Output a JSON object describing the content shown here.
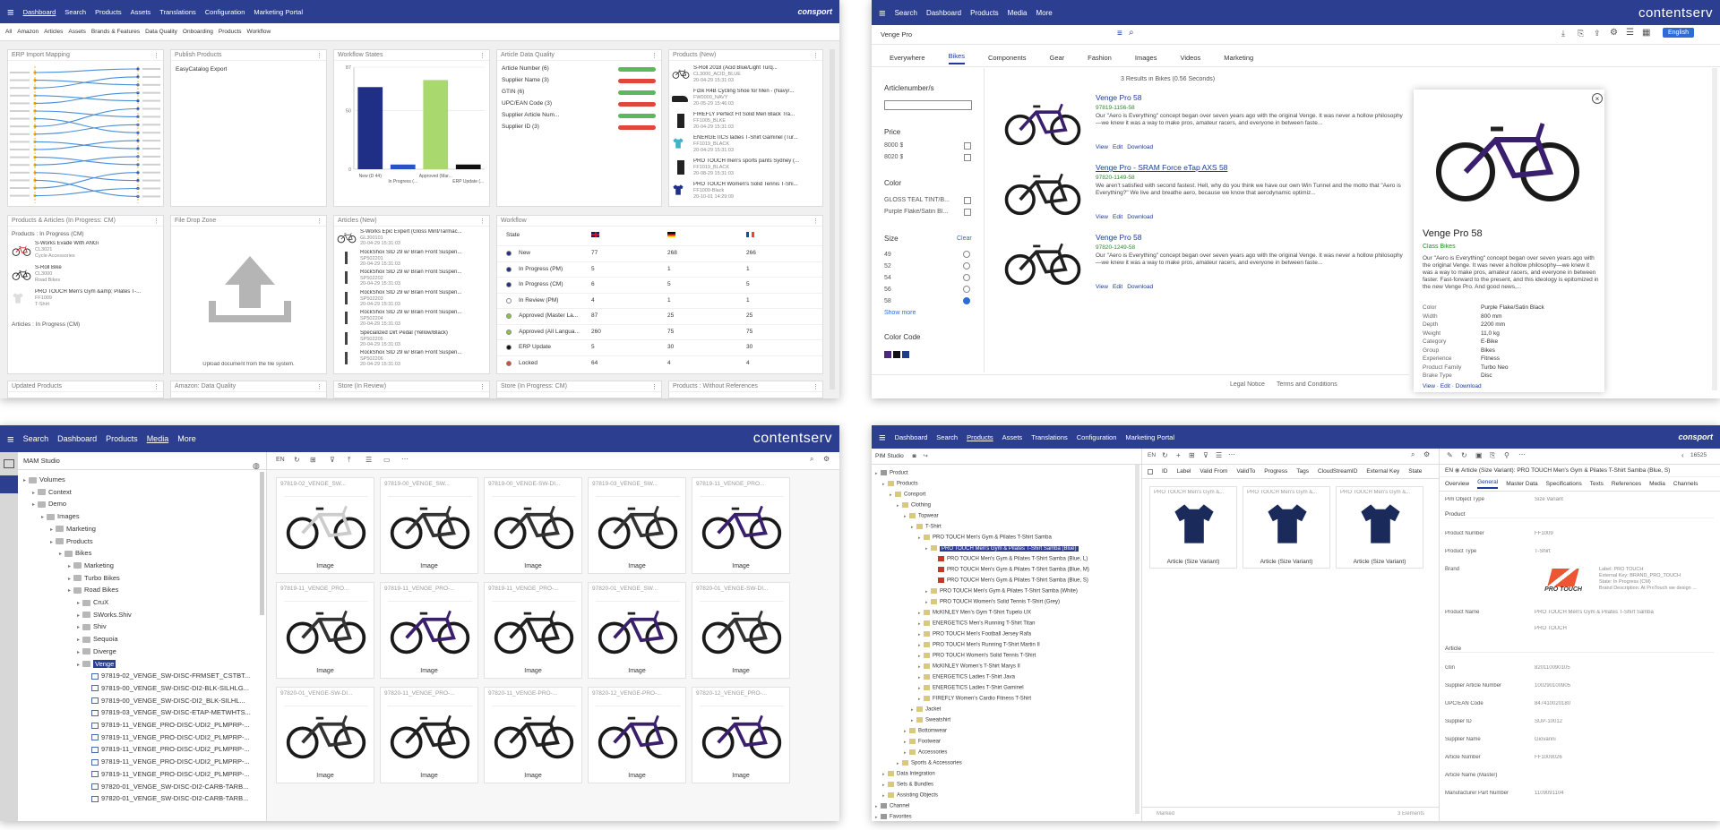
{
  "dash": {
    "nav": [
      "Dashboard",
      "Search",
      "Products",
      "Assets",
      "Translations",
      "Configuration",
      "Marketing Portal"
    ],
    "brand": "consport",
    "subnav": [
      "All",
      "Amazon",
      "Articles",
      "Assets",
      "Brands & Features",
      "Data Quality",
      "Onboarding",
      "Products",
      "Workflow"
    ],
    "cards": {
      "erp": "ERP Import Mapping",
      "publish": "Publish Products",
      "publish_item": "EasyCatalog Export",
      "wf_states": "Workflow States",
      "quality": "Article Data Quality",
      "prod_new": "Products (New)",
      "prod_art": "Products & Articles (In Progress: CM)",
      "drop": "File Drop Zone",
      "art_new": "Articles (New)",
      "workflow": "Workflow",
      "updated": "Updated Products",
      "amazon": "Amazon: Data Quality",
      "store_rev": "Store (In Review)",
      "store_prog": "Store (In Progress: CM)",
      "prod_noref": "Products : Without References"
    },
    "wf_bars": [
      {
        "label": "New (D 44)",
        "value": 70,
        "color": "#1f2f86"
      },
      {
        "label": "In Progress (...",
        "value": 4,
        "color": "#2b50c7"
      },
      {
        "label": "Approved (Mar...",
        "value": 76,
        "color": "#a8d86e"
      },
      {
        "label": "ERP Update (...",
        "value": 4,
        "color": "#111111"
      }
    ],
    "wf_ymax": 87,
    "wf_yticks": [
      "87",
      "50",
      "0"
    ],
    "quality_rows": [
      {
        "label": "Article Number (6)",
        "color": "#5cb85c"
      },
      {
        "label": "Supplier Name (3)",
        "color": "#e0473c"
      },
      {
        "label": "GTIN (6)",
        "color": "#5cb85c"
      },
      {
        "label": "UPC/EAN Code (3)",
        "color": "#e0473c"
      },
      {
        "label": "Supplier Article Num...",
        "color": "#5cb85c"
      },
      {
        "label": "Supplier ID (3)",
        "color": "#e0473c"
      }
    ],
    "prod_new_items": [
      {
        "t": "S-Roll 2018 (Acid Blue/Light Turq...",
        "s": "CL3000_ACID_BLUE",
        "d": "20-04-29 15:31:03"
      },
      {
        "t": "Fizik R4B Cycling Shoe for Men - (Navy/...",
        "s": "FW0000_NAVY",
        "d": "20-05-29 15:46:03"
      },
      {
        "t": "FIREFLY Perfect Fit Solid Men Black Tra...",
        "s": "FF1005_BLKE",
        "d": "20-04-29 15:31:03"
      },
      {
        "t": "ENERGETICS ladies T-Shirt Gaminel (Tur...",
        "s": "FF1019_BLACK",
        "d": "20-04-29 15:31:03"
      },
      {
        "t": "PRO TOUCH men's sports pants Sydney (...",
        "s": "FF1019_BLACK",
        "d": "20-08-29 15:31:03"
      },
      {
        "t": "PRO TOUCH Women's Solid Tennis T-Shi...",
        "s": "FF1009-Black",
        "d": "20-10-01 14:29:09"
      }
    ],
    "pa_head": "Products : In Progress (CM)",
    "pa_items": [
      {
        "t": "S-Works Evade With ANGi",
        "s": "CL3021",
        "u": "Cycle Accessories"
      },
      {
        "t": "S-Roll Bike",
        "s": "CL3000",
        "u": "Road Bikes"
      },
      {
        "t": "PRO TOUCH Men's Gym &amp; Pilates T-...",
        "s": "FF1009",
        "u": "T-Shirt"
      }
    ],
    "pa_foot": "Articles : In Progress (CM)",
    "drop_text": "Upload document from the file system.",
    "art_items": [
      {
        "t": "S-Works Epic Expert (Gloss Mint/Tarmac...",
        "s": "GL300101",
        "d": "20-04-29 15:31:03"
      },
      {
        "t": "RockShox SID 29 w/ Brain Front Suspen...",
        "s": "SP502201",
        "d": "20-04-29 15:31:03"
      },
      {
        "t": "RockShox SID 29 w/ Brain Front Suspen...",
        "s": "SP502202",
        "d": "20-04-29 15:31:03"
      },
      {
        "t": "RockShox SID 29 w/ Brain Front Suspen...",
        "s": "SP502203",
        "d": "20-04-29 15:31:03"
      },
      {
        "t": "RockShox SID 29 w/ Brain Front Suspen...",
        "s": "SP502204",
        "d": "20-04-29 15:31:03"
      },
      {
        "t": "Specialized Dirt Pedal (Yellow/Black)",
        "s": "SP502205",
        "d": "20-04-29 15:31:03"
      },
      {
        "t": "RockShox SID 29 w/ Brain Front Suspen...",
        "s": "SP502206",
        "d": "20-04-29 15:31:03"
      }
    ],
    "wf_table_head": "State",
    "wf_rows": [
      {
        "s": "New",
        "a": "77",
        "b": "268",
        "c": "266",
        "col": "#1f2f86"
      },
      {
        "s": "In Progress (PM)",
        "a": "5",
        "b": "1",
        "c": "1",
        "col": "#1f2f86"
      },
      {
        "s": "In Progress (CM)",
        "a": "6",
        "b": "5",
        "c": "5",
        "col": "#1f2f86"
      },
      {
        "s": "In Review (PM)",
        "a": "4",
        "b": "1",
        "c": "1",
        "col": "#ffffff"
      },
      {
        "s": "Approved (Master La...",
        "a": "87",
        "b": "25",
        "c": "25",
        "col": "#8bc34a"
      },
      {
        "s": "Approved (All Langua...",
        "a": "260",
        "b": "75",
        "c": "75",
        "col": "#8bc34a"
      },
      {
        "s": "ERP Update",
        "a": "5",
        "b": "30",
        "c": "30",
        "col": "#111111"
      },
      {
        "s": "Locked",
        "a": "64",
        "b": "4",
        "c": "4",
        "col": "#e0473c"
      }
    ]
  },
  "search": {
    "query": "Venge Pro",
    "nav": [
      "Search",
      "Dashboard",
      "Products",
      "Media",
      "More"
    ],
    "brand": "contentserv",
    "lang": "English",
    "tabs": [
      "Everywhere",
      "Bikes",
      "Components",
      "Gear",
      "Fashion",
      "Images",
      "Videos",
      "Marketing"
    ],
    "facets": {
      "artnum": "Articlenumber/s",
      "price": "Price",
      "prices": [
        "8000 $",
        "8020 $"
      ],
      "color": "Color",
      "colors": [
        "GLOSS TEAL TINT/B...",
        "Purple Flake/Satin Bl..."
      ],
      "size": "Size",
      "clear": "Clear",
      "sizes": [
        "49",
        "52",
        "54",
        "56",
        "58"
      ],
      "show_more": "Show more",
      "colorcode": "Color Code"
    },
    "results_count": "3 Results in Bikes (0.56 Seconds)",
    "results": [
      {
        "title": "Venge Pro 58",
        "id": "97819-1156-58",
        "desc": "Our \"Aero is Everything\" concept began over seven years ago with the original Venge. It was never a hollow philosophy—we knew it was a way to make pros, amateur racers, and everyone in between faste..."
      },
      {
        "title": "Venge Pro - SRAM Force eTap AXS 58",
        "id": "97820-1149-58",
        "desc": "We aren't satisfied with second fastest. Hell, why do you think we have our own Win Tunnel and the motto that \"Aero is Everything?\" We live and breathe aero, because we know that aerodynamic optimiz..."
      },
      {
        "title": "Venge Pro 58",
        "id": "97820-1249-58",
        "desc": "Our \"Aero is Everything\" concept began over seven years ago with the original Venge. It was never a hollow philosophy—we knew it was a way to make pros, amateur racers, and everyone in between faste..."
      }
    ],
    "links": [
      "View",
      "Edit",
      "Download"
    ],
    "detail": {
      "title": "Venge Pro 58",
      "class": "Class Bikes",
      "desc": "Our \"Aero is Everything\" concept began over seven years ago with the original Venge. It was never a hollow philosophy—we knew it was a way to make pros, amateur racers, and everyone in between faster. Fast-forward to the present, and this ideology is epitomized in the new Venge Pro. And good news,...",
      "props": [
        [
          "Color",
          "Purple Flake/Satin Black"
        ],
        [
          "Width",
          "800 mm"
        ],
        [
          "Depth",
          "2200 mm"
        ],
        [
          "Weight",
          "11,0 kg"
        ],
        [
          "Category",
          "E-Bike"
        ],
        [
          "Group",
          "Bikes"
        ],
        [
          "Experience",
          "Fitness"
        ],
        [
          "Product Family",
          "Turbo Neo"
        ],
        [
          "Brake Type",
          "Disc"
        ]
      ]
    },
    "footer": [
      "Legal Notice",
      "Terms and Conditions"
    ]
  },
  "mam": {
    "nav": [
      "Search",
      "Dashboard",
      "Products",
      "Media",
      "More"
    ],
    "brand": "contentserv",
    "title": "MAM Studio",
    "lang": "EN",
    "tree": [
      {
        "t": "Volumes",
        "l": 0,
        "k": "f"
      },
      {
        "t": "Context",
        "l": 1,
        "k": "f"
      },
      {
        "t": "Demo",
        "l": 1,
        "k": "f"
      },
      {
        "t": "Images",
        "l": 2,
        "k": "f"
      },
      {
        "t": "Marketing",
        "l": 3,
        "k": "f"
      },
      {
        "t": "Products",
        "l": 3,
        "k": "f"
      },
      {
        "t": "Bikes",
        "l": 4,
        "k": "f"
      },
      {
        "t": "Marketing",
        "l": 5,
        "k": "f"
      },
      {
        "t": "Turbo Bikes",
        "l": 5,
        "k": "f"
      },
      {
        "t": "Road Bikes",
        "l": 5,
        "k": "f"
      },
      {
        "t": "CruX",
        "l": 6,
        "k": "f"
      },
      {
        "t": "SWorks.Shiv",
        "l": 6,
        "k": "f"
      },
      {
        "t": "Shiv",
        "l": 6,
        "k": "f"
      },
      {
        "t": "Sequoia",
        "l": 6,
        "k": "f"
      },
      {
        "t": "Diverge",
        "l": 6,
        "k": "f"
      },
      {
        "t": "Venge",
        "l": 6,
        "k": "s"
      },
      {
        "t": "97819-02_VENGE_SW-DISC-FRMSET_CSTBT...",
        "l": 7,
        "k": "i"
      },
      {
        "t": "97819-00_VENGE_SW-DISC-DI2-BLK-SILHLG...",
        "l": 7,
        "k": "i"
      },
      {
        "t": "97819-00_VENGE_SW-DISC-DI2_BLK-SILHL...",
        "l": 7,
        "k": "i"
      },
      {
        "t": "97819-03_VENGE_SW-DISC-ETAP-METWHTS...",
        "l": 7,
        "k": "i"
      },
      {
        "t": "97819-11_VENGE_PRO-DISC-UDI2_PLMPRP-...",
        "l": 7,
        "k": "i"
      },
      {
        "t": "97819-11_VENGE_PRO-DISC-UDI2_PLMPRP-...",
        "l": 7,
        "k": "i"
      },
      {
        "t": "97819-11_VENGE_PRO-DISC-UDI2_PLMPRP-...",
        "l": 7,
        "k": "i"
      },
      {
        "t": "97819-11_VENGE_PRO-DISC-UDI2_PLMPRP-...",
        "l": 7,
        "k": "i"
      },
      {
        "t": "97819-11_VENGE_PRO-DISC-UDI2_PLMPRP-...",
        "l": 7,
        "k": "i"
      },
      {
        "t": "97820-01_VENGE_SW-DISC-DI2-CARB-TARB...",
        "l": 7,
        "k": "i"
      },
      {
        "t": "97820-01_VENGE_SW-DISC-DI2-CARB-TARB...",
        "l": 7,
        "k": "i"
      }
    ],
    "grid": [
      "97819-02_VENGE_SW...",
      "97819-00_VENGE_SW...",
      "97819-00_VENGE-SW-DI...",
      "97819-03_VENGE_SW...",
      "97819-11_VENGE_PRO...",
      "97819-11_VENGE_PRO...",
      "97819-11_VENGE_PRO-...",
      "97819-11_VENGE_PRO-...",
      "97820-01_VENGE_SW...",
      "97820-01_VENGE-SW-DI...",
      "97820-01_VENGE-SW-DI...",
      "97820-11_VENGE_PRO-...",
      "97820-11_VENGE-PRO-...",
      "97820-12_VENGE-PRO-...",
      "97820-12_VENGE_PRO-..."
    ],
    "caption": "Image"
  },
  "pim": {
    "nav": [
      "Dashboard",
      "Search",
      "Products",
      "Assets",
      "Translations",
      "Configuration",
      "Marketing Portal"
    ],
    "brand": "consport",
    "studio": "PIM Studio",
    "tree": [
      {
        "t": "Product",
        "l": 0
      },
      {
        "t": "Products",
        "l": 1
      },
      {
        "t": "Consport",
        "l": 2
      },
      {
        "t": "Clothing",
        "l": 3
      },
      {
        "t": "Topwear",
        "l": 4
      },
      {
        "t": "T-Shirt",
        "l": 5
      },
      {
        "t": "PRO TOUCH Men's Gym & Pilates T-Shirt Samba",
        "l": 6
      },
      {
        "t": "PRO TOUCH Men's Gym & Pilates T-Shirt Samba (Blue)",
        "l": 7,
        "sel": true
      },
      {
        "t": "PRO TOUCH Men's Gym & Pilates T-Shirt Samba (Blue, L)",
        "l": 8
      },
      {
        "t": "PRO TOUCH Men's Gym & Pilates T-Shirt Samba (Blue, M)",
        "l": 8
      },
      {
        "t": "PRO TOUCH Men's Gym & Pilates T-Shirt Samba (Blue, S)",
        "l": 8
      },
      {
        "t": "PRO TOUCH Men's Gym & Pilates T-Shirt Samba (White)",
        "l": 7
      },
      {
        "t": "PRO TOUCH Women's Solid Tennis T-Shirt (Grey)",
        "l": 7
      },
      {
        "t": "McKINLEY Men's Gym T-Shirt Tupelo UX",
        "l": 6
      },
      {
        "t": "ENERGETICS Men's Running T-Shirt Titan",
        "l": 6
      },
      {
        "t": "PRO TOUCH Men's Football Jersey Rafa",
        "l": 6
      },
      {
        "t": "PRO TOUCH Men's Running T-Shirt Martin II",
        "l": 6
      },
      {
        "t": "PRO TOUCH Women's Solid Tennis T-Shirt",
        "l": 6
      },
      {
        "t": "McKINLEY Women's T-Shirt Marys II",
        "l": 6
      },
      {
        "t": "ENERGETICS Ladies T-Shirt Java",
        "l": 6
      },
      {
        "t": "ENERGETICS Ladies T-Shirt Gaminel",
        "l": 6
      },
      {
        "t": "FIREFLY Women's Cardio Fitness T-Shirt",
        "l": 6
      },
      {
        "t": "Jacket",
        "l": 5
      },
      {
        "t": "Sweatshirt",
        "l": 5
      },
      {
        "t": "Bottomwear",
        "l": 4
      },
      {
        "t": "Footwear",
        "l": 4
      },
      {
        "t": "Accessories",
        "l": 4
      },
      {
        "t": "Sports & Accessories",
        "l": 3
      },
      {
        "t": "Data Integration",
        "l": 1
      },
      {
        "t": "Sets & Bundles",
        "l": 1
      },
      {
        "t": "Assisting Objects",
        "l": 1
      },
      {
        "t": "Channel",
        "l": 0
      },
      {
        "t": "Favorites",
        "l": 0
      }
    ],
    "mid_cols": [
      "ID",
      "Label",
      "Valid From",
      "ValidTo",
      "Progress",
      "Tags",
      "CloudStreamID",
      "External Key",
      "State"
    ],
    "mid_cards": [
      "PRO TOUCH Men's Gym &...",
      "PRO TOUCH Men's Gym &...",
      "PRO TOUCH Men's Gym &..."
    ],
    "mid_caption": "Article (Size Variant)",
    "mid_lang": "EN",
    "mid_footer_l": "Marked",
    "mid_footer_r": "3 Elements",
    "right_path": "Article (Size Variant): PRO TOUCH Men's Gym & Pilates T-Shirt Samba (Blue, S)",
    "right_lang": "EN",
    "count": "16525",
    "right_tabs": [
      "Overview",
      "General",
      "Master Data",
      "Specifications",
      "Texts",
      "References",
      "Media",
      "Channels"
    ],
    "obj_type_l": "Pim Object Type",
    "obj_type_v": "Size Variant",
    "sec_product": "Product",
    "fields_p": [
      [
        "Product Number",
        "FF1009"
      ],
      [
        "Product Type",
        "T-Shirt"
      ]
    ],
    "brand_l": "Brand",
    "brand_logo": "PRO TOUCH",
    "brand_info": [
      "Label: PRO TOUCH",
      "External Key: BRAND_PRO_TOUCH",
      "State: In Progress (CM)",
      "Brand Description: At ProTouch we design ..."
    ],
    "fields_p2": [
      [
        "Product Name",
        "PRO TOUCH Men's Gym & Pilates T-Shirt Samba"
      ],
      [
        "",
        "PRO TOUCH"
      ]
    ],
    "sec_article": "Article",
    "fields_a": [
      [
        "Gtin",
        "820110090105"
      ],
      [
        "Supplier Article Number",
        "100290100905"
      ],
      [
        "UPC/EAN Code",
        "847410020180"
      ],
      [
        "Supplier ID",
        "SUP-10012"
      ],
      [
        "Supplier Name",
        "Giovanni"
      ],
      [
        "Article Number",
        "FF1009026"
      ],
      [
        "Article Name (Master)",
        ""
      ],
      [
        "Manufacturer Part Number",
        "1109091104"
      ]
    ]
  }
}
